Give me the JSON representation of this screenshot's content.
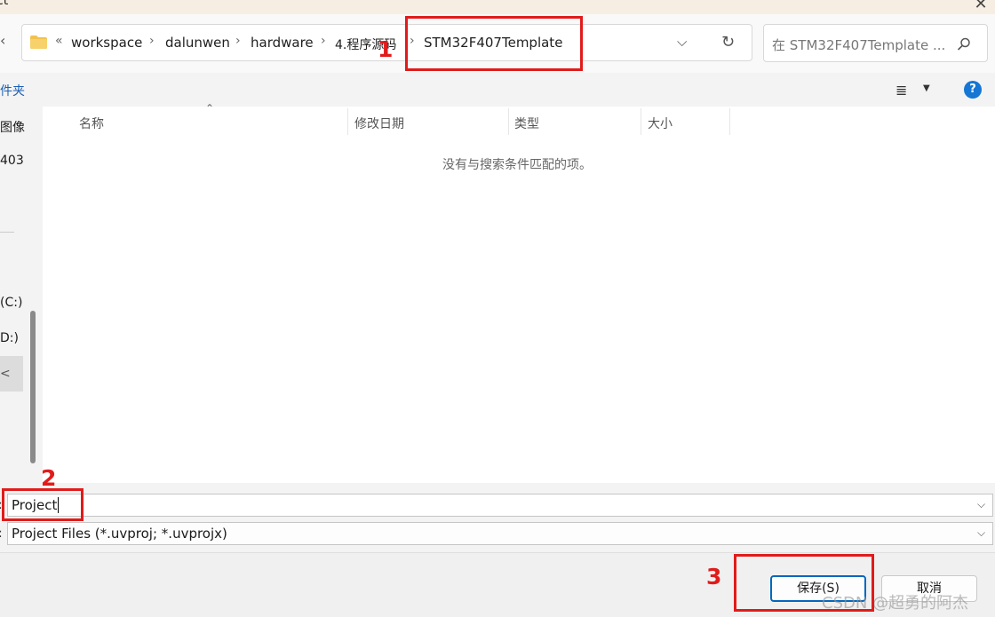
{
  "window": {
    "title": "ct",
    "close_icon": "close-icon"
  },
  "address": {
    "back_chevron": "‹",
    "overflow": "«",
    "crumbs": [
      "workspace",
      "dalunwen",
      "hardware",
      "4.程序源码",
      "STM32F407Template"
    ],
    "dropdown_icon": "chevron-down-icon",
    "refresh_icon": "refresh-icon"
  },
  "search": {
    "placeholder": "在 STM32F407Template ...",
    "icon": "search-icon"
  },
  "toolbar": {
    "new_folder": "件夹",
    "view_icon": "view-list-icon",
    "help": "?"
  },
  "nav": {
    "items": [
      "图像",
      "403",
      "(C:)",
      "D:)",
      "<"
    ]
  },
  "filelist": {
    "columns": [
      "名称",
      "修改日期",
      "类型",
      "大小"
    ],
    "empty_message": "没有与搜索条件匹配的项。"
  },
  "fields": {
    "filename_label": ":",
    "filename_value": "Project",
    "filetype_label": ":",
    "filetype_value": "Project Files (*.uvproj; *.uvprojx)"
  },
  "buttons": {
    "save": "保存(S)",
    "cancel": "取消"
  },
  "annotations": {
    "one": "1",
    "two": "2",
    "three": "3"
  },
  "watermark": "CSDN @超勇的阿杰",
  "colors": {
    "accent": "#0067c0",
    "annotation": "#e11b1b",
    "folder": "#f2c14e"
  }
}
